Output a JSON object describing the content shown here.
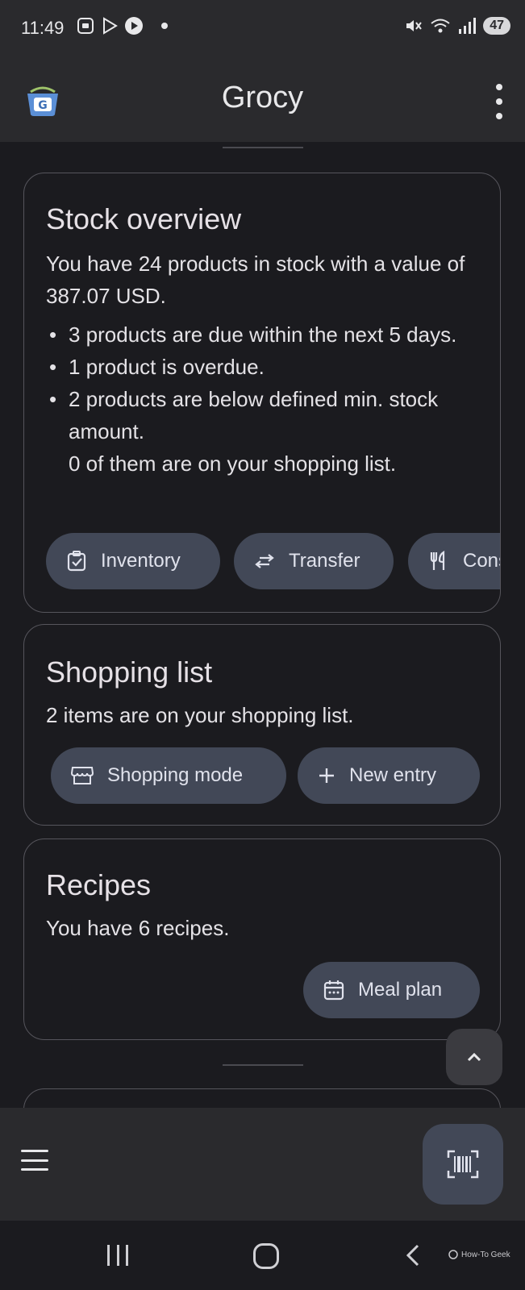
{
  "status_bar": {
    "time": "11:49",
    "battery": "47"
  },
  "app_bar": {
    "title": "Grocy",
    "logo_letter": "G"
  },
  "stock_card": {
    "title": "Stock overview",
    "summary": "You have 24 products in stock with a value of 387.07 USD.",
    "bullets": [
      "3 products are due within the next 5 days.",
      "1 product is overdue.",
      "2 products are below defined min. stock amount."
    ],
    "shopping_note": "0 of them are on your shopping list.",
    "buttons": {
      "inventory": "Inventory",
      "transfer": "Transfer",
      "consume": "Consume"
    }
  },
  "shopping_card": {
    "title": "Shopping list",
    "summary": "2 items are on your shopping list.",
    "buttons": {
      "shopping_mode": "Shopping mode",
      "new_entry": "New entry"
    }
  },
  "recipes_card": {
    "title": "Recipes",
    "summary": "You have 6 recipes.",
    "buttons": {
      "meal_plan": "Meal plan"
    }
  },
  "watermark": "How-To Geek",
  "icons": {
    "inventory": "clipboard-check-icon",
    "transfer": "swap-arrows-icon",
    "consume": "fork-knife-icon",
    "shopping_mode": "storefront-icon",
    "new_entry": "plus-icon",
    "meal_plan": "calendar-icon",
    "scroll_top": "chevron-up-icon",
    "menu": "hamburger-menu-icon",
    "scan": "barcode-scan-icon"
  },
  "colors": {
    "background": "#1b1b1f",
    "bars": "#2a2a2d",
    "chip": "#424857",
    "card_border": "#56555c",
    "text": "#e4e2e6"
  }
}
